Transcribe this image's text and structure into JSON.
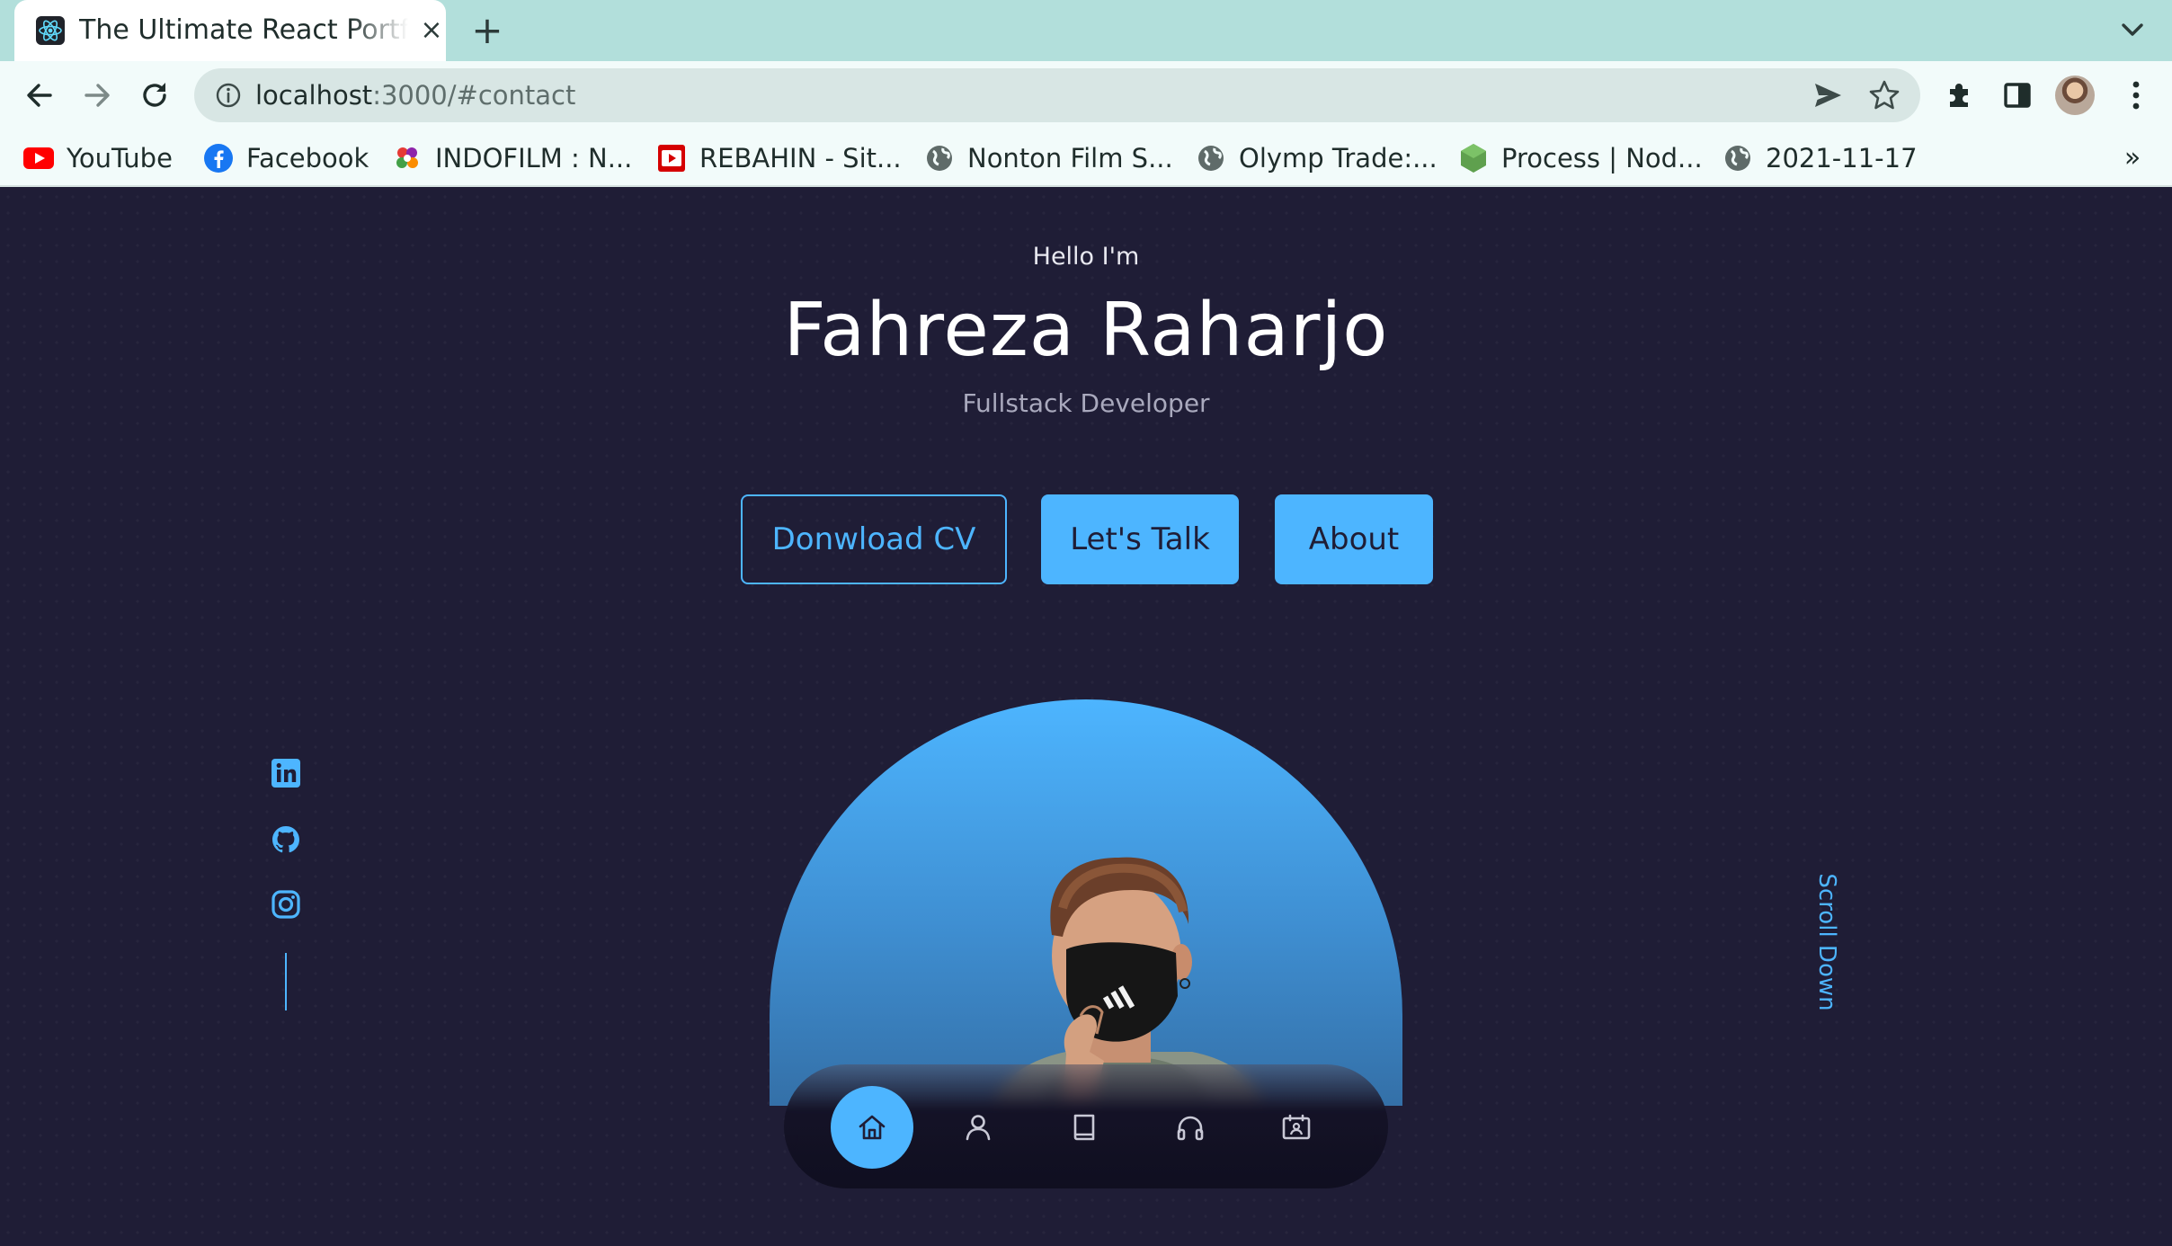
{
  "browser": {
    "tab_title": "The Ultimate React Portfolio",
    "tab_close": "×",
    "new_tab": "+",
    "url_host": "localhost",
    "url_path": ":3000/#contact",
    "bookmarks": [
      {
        "label": "YouTube",
        "icon": "youtube-icon"
      },
      {
        "label": "Facebook",
        "icon": "facebook-icon"
      },
      {
        "label": "INDOFILM : N...",
        "icon": "indofilm-icon"
      },
      {
        "label": "REBAHIN - Sit...",
        "icon": "rebahin-icon"
      },
      {
        "label": "Nonton Film S...",
        "icon": "globe-icon"
      },
      {
        "label": "Olymp Trade:...",
        "icon": "globe-icon"
      },
      {
        "label": "Process | Nod...",
        "icon": "nodejs-icon"
      },
      {
        "label": "2021-11-17",
        "icon": "globe-icon"
      }
    ],
    "bookmarks_more": "»"
  },
  "hero": {
    "greeting": "Hello I'm",
    "name": "Fahreza Raharjo",
    "role": "Fullstack Developer",
    "buttons": {
      "download_cv": "Donwload CV",
      "lets_talk": "Let's Talk",
      "about": "About"
    },
    "scroll_down": "Scroll Down"
  },
  "socials": [
    "linkedin-icon",
    "github-icon",
    "instagram-icon"
  ],
  "bottom_nav": {
    "items": [
      "home-icon",
      "user-icon",
      "book-icon",
      "headphones-icon",
      "contact-card-icon"
    ],
    "active_index": 0
  },
  "colors": {
    "accent": "#4db5ff",
    "background": "#1f1d36",
    "tab_strip": "#b2dfdb"
  }
}
